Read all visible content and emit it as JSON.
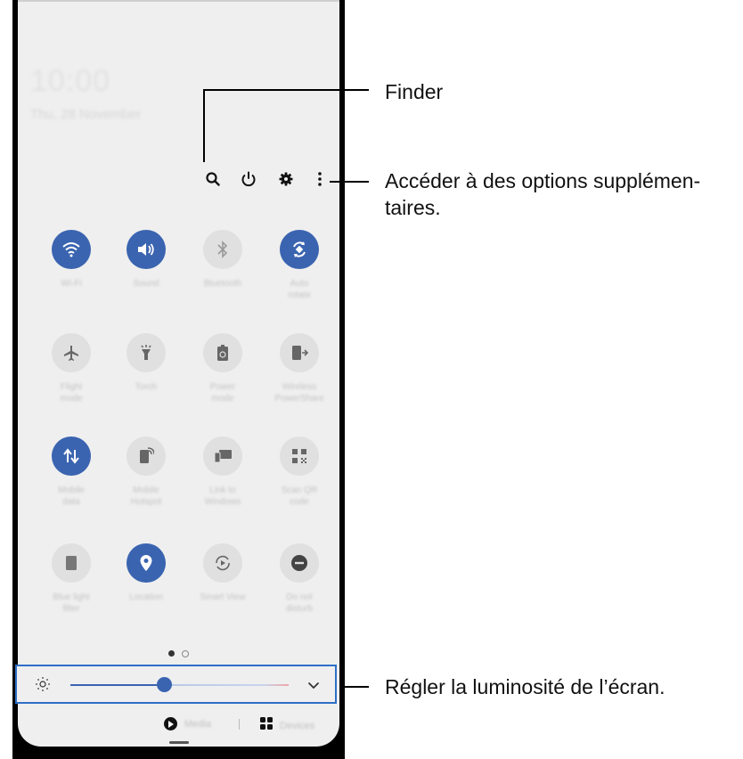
{
  "status": {
    "time": "10:00",
    "date": "Thu, 28 November"
  },
  "top_icons": [
    {
      "name": "search-icon"
    },
    {
      "name": "power-icon"
    },
    {
      "name": "gear-icon"
    },
    {
      "name": "more-options-icon"
    }
  ],
  "tiles": [
    {
      "label": "Wi-Fi",
      "state": "on",
      "icon": "wifi-icon"
    },
    {
      "label": "Sound",
      "state": "on",
      "icon": "sound-icon"
    },
    {
      "label": "Bluetooth",
      "state": "off",
      "icon": "bluetooth-icon"
    },
    {
      "label": "Auto\nrotate",
      "state": "on",
      "icon": "auto-rotate-icon"
    },
    {
      "label": "Flight\nmode",
      "state": "off",
      "icon": "airplane-icon"
    },
    {
      "label": "Torch",
      "state": "off",
      "icon": "torch-icon"
    },
    {
      "label": "Power\nmode",
      "state": "off",
      "icon": "battery-icon"
    },
    {
      "label": "Wireless\nPowerShare",
      "state": "off",
      "icon": "powershare-icon"
    },
    {
      "label": "Mobile\ndata",
      "state": "on",
      "icon": "mobile-data-icon"
    },
    {
      "label": "Mobile\nHotspot",
      "state": "off",
      "icon": "hotspot-icon"
    },
    {
      "label": "Link to\nWindows",
      "state": "off",
      "icon": "link-windows-icon"
    },
    {
      "label": "Scan QR\ncode",
      "state": "off",
      "icon": "qr-icon"
    },
    {
      "label": "Blue light\nfilter",
      "state": "off",
      "icon": "blue-light-icon"
    },
    {
      "label": "Location",
      "state": "on",
      "icon": "location-icon"
    },
    {
      "label": "Smart View",
      "state": "off",
      "icon": "smart-view-icon"
    },
    {
      "label": "Do not\ndisturb",
      "state": "off",
      "icon": "dnd-icon"
    }
  ],
  "pager": {
    "active": 0,
    "count": 2
  },
  "brightness": {
    "level": 0.43
  },
  "bottom": {
    "media_label": "Media",
    "devices_label": "Devices"
  },
  "callouts": {
    "finder": "Finder",
    "options": "Accéder à des options supplémen-\ntaires.",
    "brightness": "Régler la luminosité de l’écran."
  },
  "colors": {
    "accent": "#3a64b0",
    "highlight_border": "#2e6fc7"
  }
}
